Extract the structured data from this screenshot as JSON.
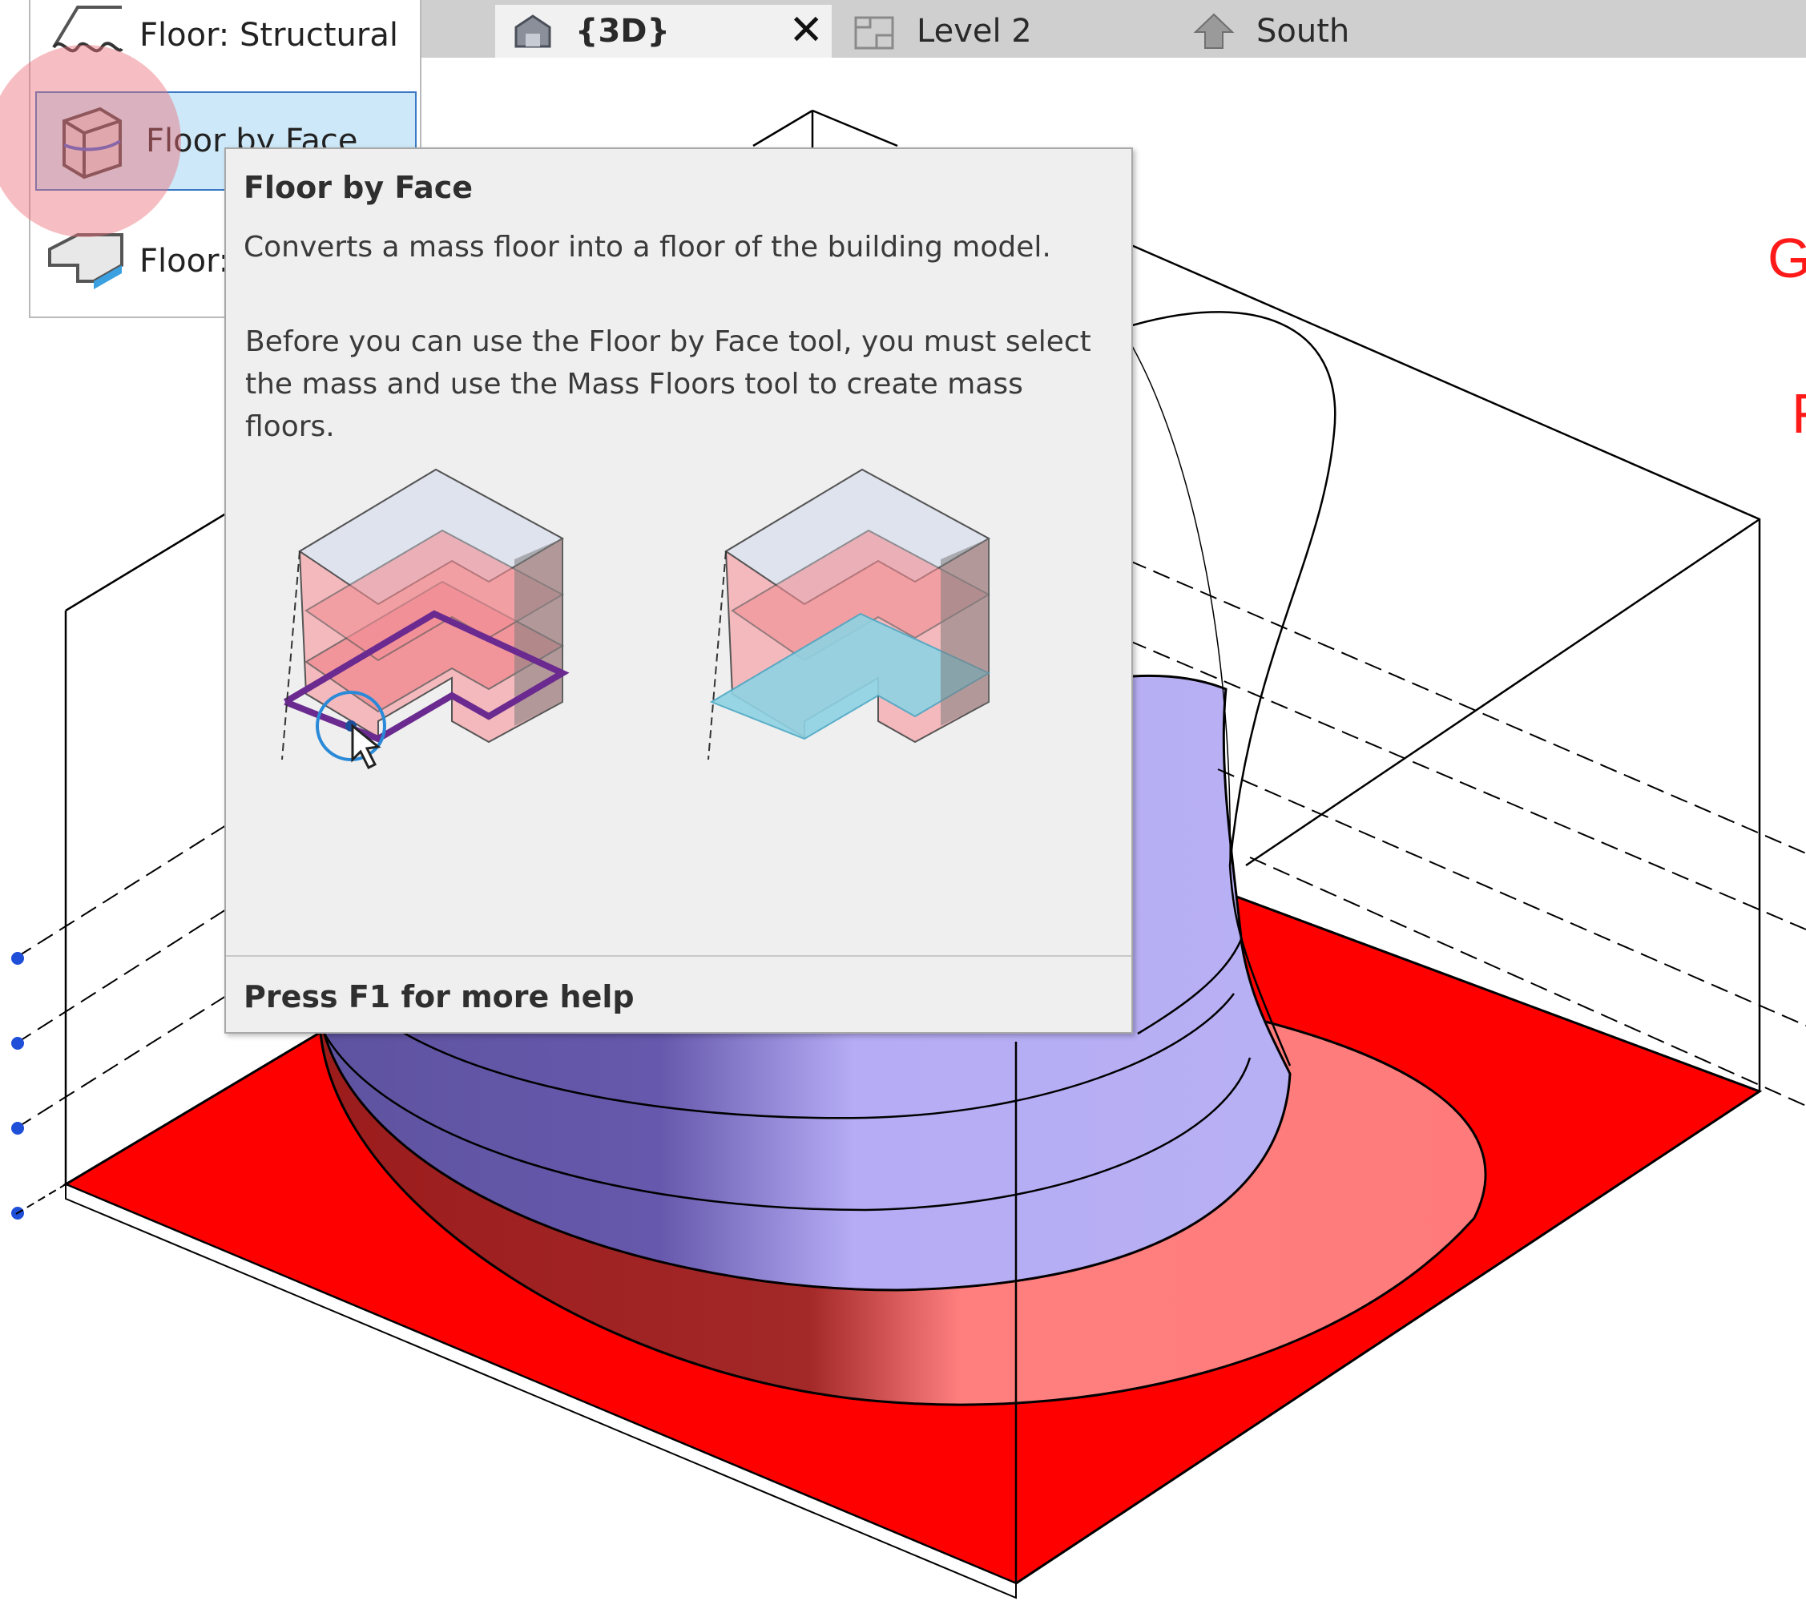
{
  "tabs": [
    {
      "label": "{3D}",
      "icon": "home-3d-icon",
      "active": true,
      "closable": true
    },
    {
      "label": "Level 2",
      "icon": "floor-plan-icon",
      "active": false
    },
    {
      "label": "South",
      "icon": "elevation-icon",
      "active": false
    }
  ],
  "dropdown": {
    "items": [
      {
        "label": "Floor: Structural",
        "icon": "structural-floor-icon"
      },
      {
        "label": "Floor by Face",
        "icon": "floor-by-face-icon",
        "highlighted": true
      },
      {
        "label": "Floor:",
        "icon": "floor-icon"
      }
    ]
  },
  "tooltip": {
    "title": "Floor by Face",
    "description": "Converts a mass floor into a floor of the building model.",
    "note": "Before you can use the Floor by Face tool, you must select the mass and use the Mass Floors tool to create mass floors.",
    "help": "Press F1 for more help"
  },
  "viewport": {
    "labels": [
      "G",
      "F"
    ]
  },
  "colors": {
    "slab": "#ff0000",
    "mass": "#b5acf5",
    "mass_dark": "#5e53a0",
    "highlight_bg": "#cde8f8",
    "highlight_border": "#3b78c5"
  }
}
